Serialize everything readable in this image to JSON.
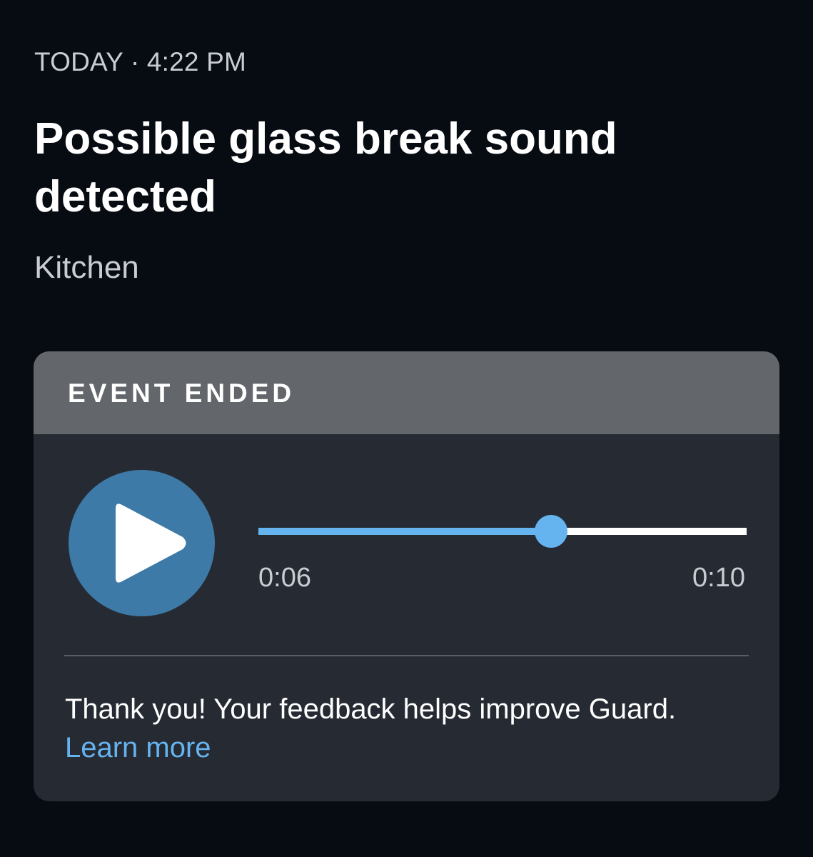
{
  "event": {
    "timestamp": "TODAY · 4:22 PM",
    "title": "Possible glass break sound detected",
    "location": "Kitchen"
  },
  "card": {
    "status_label": "EVENT ENDED",
    "player": {
      "play_icon": "play-icon",
      "current_time": "0:06",
      "total_time": "0:10",
      "progress_fraction": 0.6
    },
    "feedback": {
      "message": "Thank you! Your feedback helps improve Guard.",
      "link_label": "Learn more"
    }
  },
  "colors": {
    "background": "#070b12",
    "card_body": "#262a32",
    "card_header": "#63666b",
    "play_button": "#3d7aa7",
    "accent": "#66b4ef"
  }
}
